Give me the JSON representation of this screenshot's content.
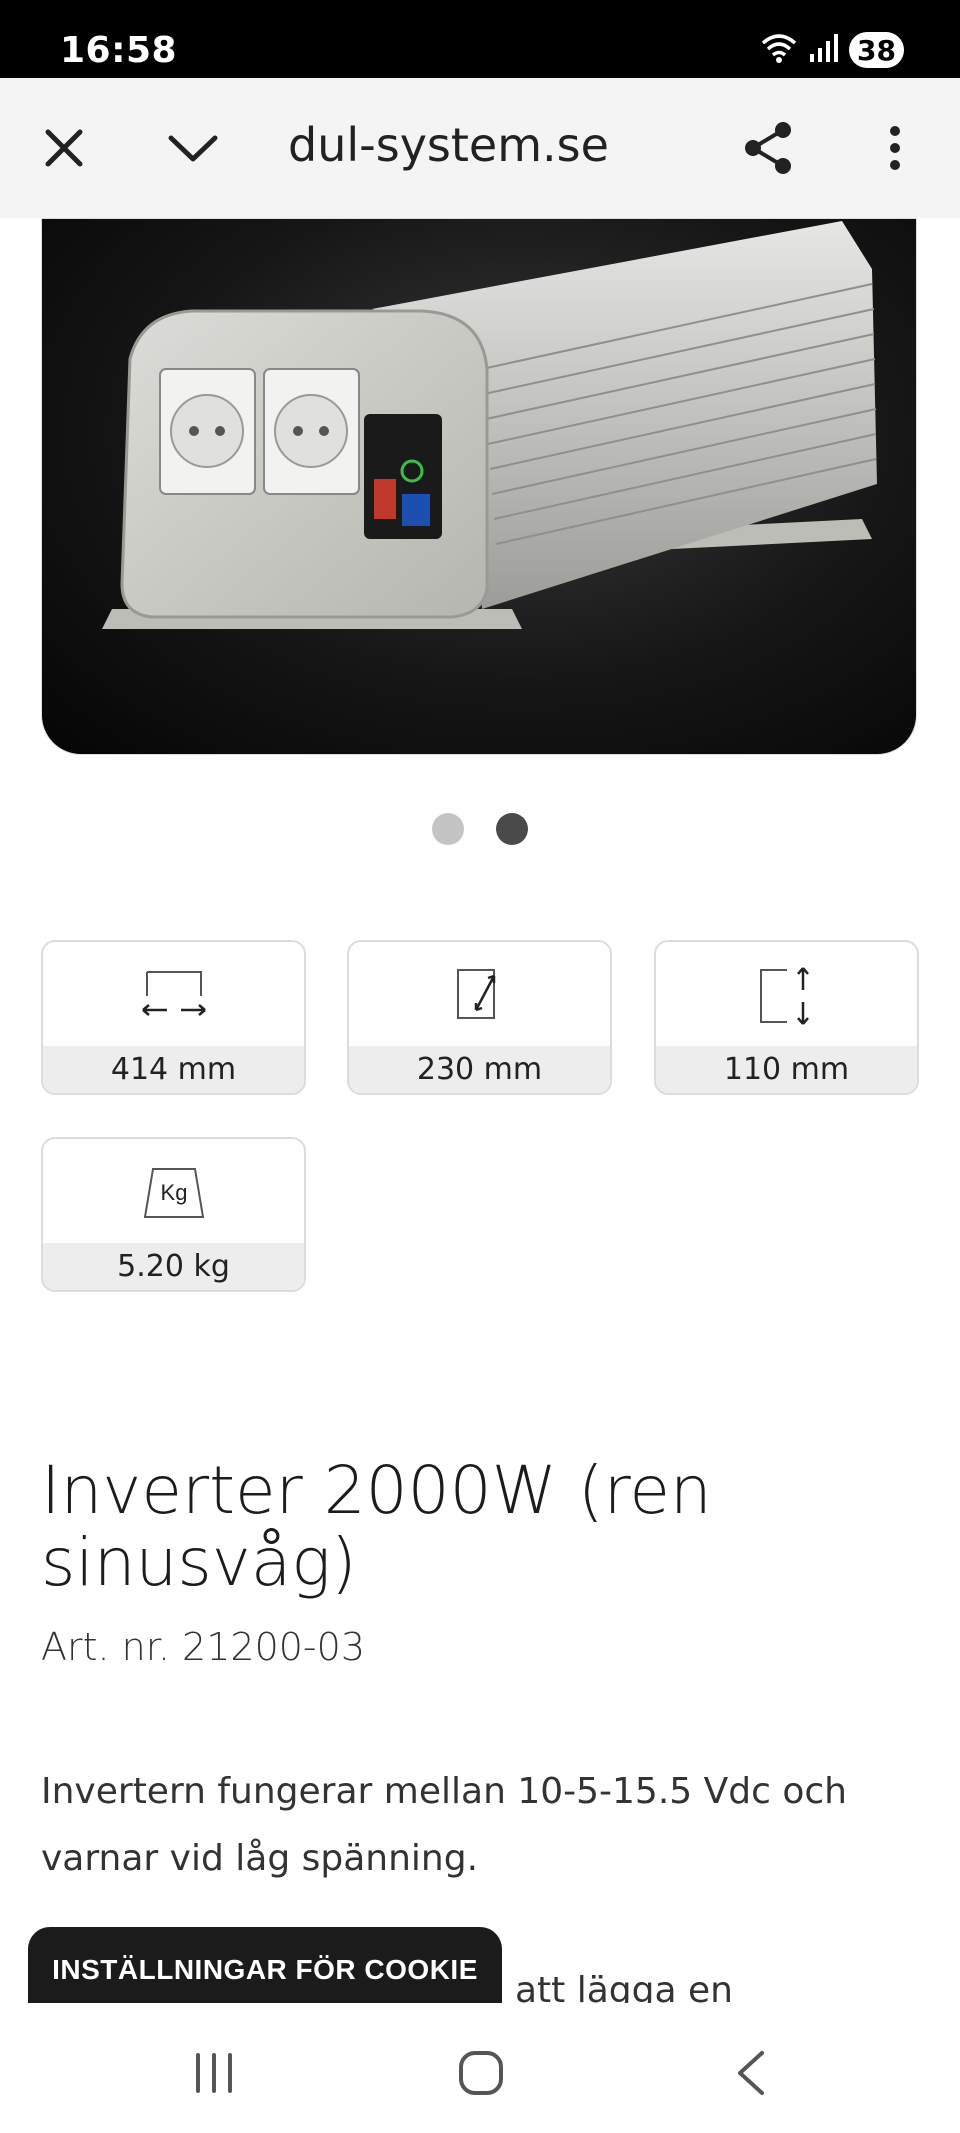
{
  "status_bar": {
    "time": "16:58",
    "battery": "38",
    "icons": [
      "wifi-icon",
      "signal-icon",
      "battery-icon"
    ]
  },
  "browser": {
    "url": "dul-system.se",
    "buttons": [
      "close-icon",
      "chevron-down-icon",
      "share-icon",
      "more-vert-icon"
    ]
  },
  "carousel": {
    "slide_count": 2,
    "active_index": 1
  },
  "specs": [
    {
      "icon": "length-icon",
      "value": "414 mm"
    },
    {
      "icon": "depth-icon",
      "value": "230 mm"
    },
    {
      "icon": "height-icon",
      "value": "110 mm"
    },
    {
      "icon": "weight-icon",
      "icon_text": "Kg",
      "value": "5.20 kg"
    }
  ],
  "product": {
    "title": "Inverter 2000W (ren sinusvåg)",
    "art_nr": "Art. nr. 21200-03",
    "description": "Invertern fungerar mellan 10-5-15.5 Vdc och varnar vid låg spänning.",
    "description_cont": "att lägga en"
  },
  "cookie_button": "INSTÄLLNINGAR FÖR COOKIE",
  "nav": [
    "recent-apps-icon",
    "home-icon",
    "back-icon"
  ]
}
